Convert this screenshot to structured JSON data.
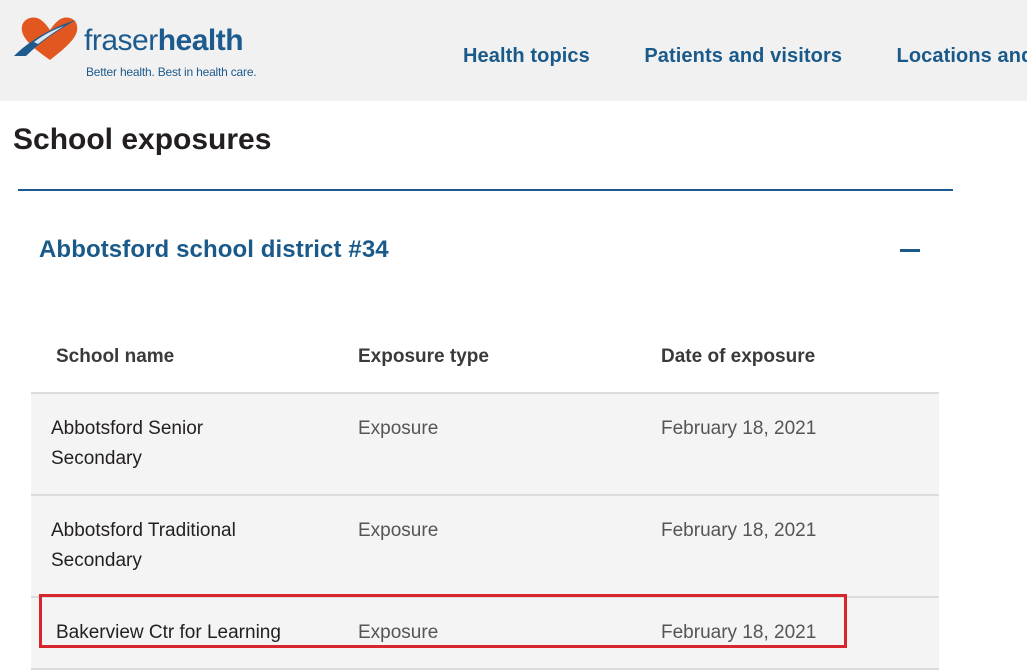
{
  "brand": {
    "name_light": "fraser",
    "name_bold": "health",
    "tagline": "Better health. Best in health care.",
    "primary_color": "#1d5b8e",
    "accent_color": "#e2561f"
  },
  "nav": {
    "items": [
      {
        "label": "Health topics"
      },
      {
        "label": "Patients and visitors"
      },
      {
        "label": "Locations and"
      }
    ]
  },
  "page": {
    "title": "School exposures"
  },
  "accordion": {
    "title": "Abbotsford school district #34",
    "expanded": true,
    "toggle_icon": "minus-icon"
  },
  "table": {
    "columns": [
      "School name",
      "Exposure type",
      "Date of exposure"
    ],
    "rows": [
      {
        "school": "Abbotsford Senior Secondary",
        "type": "Exposure",
        "date": "February 18, 2021"
      },
      {
        "school": "Abbotsford Traditional Secondary",
        "type": "Exposure",
        "date": "February 18, 2021"
      },
      {
        "school": "Bakerview Ctr for Learning",
        "type": "Exposure",
        "date": "February 18, 2021"
      }
    ]
  },
  "highlight_color": "#d7262c"
}
